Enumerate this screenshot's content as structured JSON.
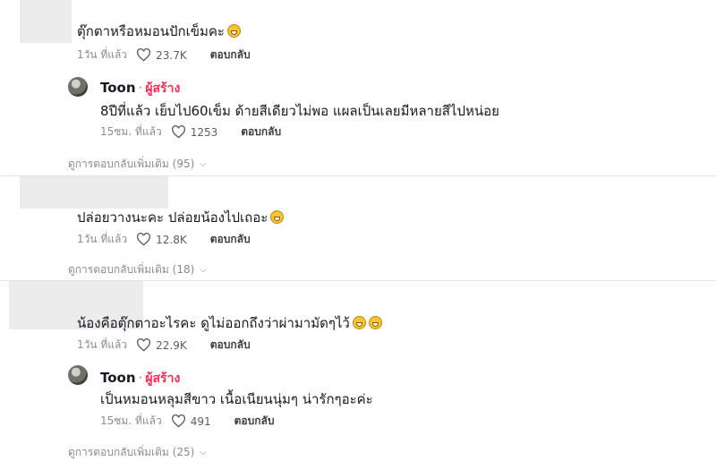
{
  "comments": [
    {
      "text": "ตุ๊กตาหรือหมอนปักเข็มคะ",
      "emoji": [
        "grinning-sweat-emoji"
      ],
      "timestamp": "1วัน ที่แล้ว",
      "likes": "23.7K",
      "reply_label": "ตอบกลับ"
    },
    {
      "text": "ปล่อยวางนะคะ ปล่อยน้องไปเถอะ",
      "emoji": [
        "rolling-laughing-emoji"
      ],
      "timestamp": "1วัน ที่แล้ว",
      "likes": "12.8K",
      "reply_label": "ตอบกลับ"
    },
    {
      "text": "น้องคือตุ๊กตาอะไรคะ ดูไม่ออกถึงว่าผ่ามามัดๆไว้",
      "emoji": [
        "tears-of-joy-emoji",
        "tears-of-joy-emoji"
      ],
      "timestamp": "1วัน ที่แล้ว",
      "likes": "22.9K",
      "reply_label": "ตอบกลับ"
    }
  ],
  "replies": [
    {
      "author": "Toon",
      "separator": "·",
      "badge": "ผู้สร้าง",
      "text": "8ปีที่แล้ว เย็บไป60เข็ม ด้ายสีเดียวไม่พอ แผลเป็นเลยมีหลายสีไปหน่อย",
      "timestamp": "15ชม. ที่แล้ว",
      "likes": "1253",
      "reply_label": "ตอบกลับ"
    },
    {
      "author": "Toon",
      "separator": "·",
      "badge": "ผู้สร้าง",
      "text": "เป็นหมอนหลุมสีขาว เนื้อเนียนนุ่มๆ น่ารักๆอะค่ะ",
      "timestamp": "15ชม. ที่แล้ว",
      "likes": "491",
      "reply_label": "ตอบกลับ"
    }
  ],
  "more_replies": [
    "ดูการตอบกลับเพิ่มเติม (95)",
    "ดูการตอบกลับเพิ่มเติม (18)",
    "ดูการตอบกลับเพิ่มเติม (25)"
  ],
  "icons": {
    "like": "heart-outline-icon",
    "expand": "chevron-down-icon"
  },
  "colors": {
    "creator_badge": "#fe2c55",
    "meta_text": "#8a8b91",
    "text": "#161823"
  }
}
